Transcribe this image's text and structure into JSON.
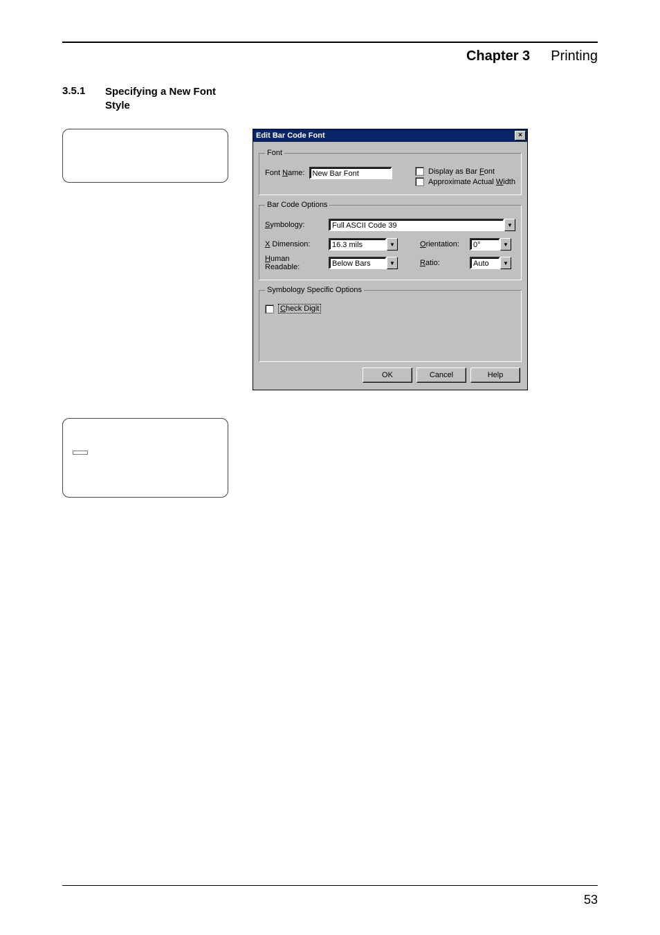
{
  "header": {
    "chapter": "Chapter 3",
    "title": "Printing"
  },
  "section": {
    "number": "3.5.1",
    "title": "Specifying a New Font Style"
  },
  "left_box1": {
    "l1": "",
    "l2": "",
    "l3": ""
  },
  "left_box2": {
    "l1": "",
    "l2": "",
    "btn": " ",
    "l3": "",
    "l4": "",
    "l5": ""
  },
  "dialog": {
    "title": "Edit Bar Code Font",
    "close": "×",
    "font_group": "Font",
    "font_name_label_pre": "Font ",
    "font_name_label_u": "N",
    "font_name_label_post": "ame:",
    "font_name_value": "New Bar Font",
    "display_barfont_pre": "Display as Bar ",
    "display_barfont_u": "F",
    "display_barfont_post": "ont",
    "approx_pre": "Approximate Actual ",
    "approx_u": "W",
    "approx_post": "idth",
    "barcode_group": "Bar Code Options",
    "symbology_u": "S",
    "symbology_post": "ymbology:",
    "symbology_value": "Full ASCII Code 39",
    "xdim_u": "X",
    "xdim_post": " Dimension:",
    "xdim_value": "16.3 mils",
    "orientation_u": "O",
    "orientation_post": "rientation:",
    "orientation_value": "0°",
    "human_u": "H",
    "human_post": "uman Readable:",
    "human_value": "Below Bars",
    "ratio_u": "R",
    "ratio_post": "atio:",
    "ratio_value": "Auto",
    "symspec_group": "Symbology Specific Options",
    "checkdigit_u": "C",
    "checkdigit_post": "heck Digit",
    "ok": "OK",
    "cancel": "Cancel",
    "help": "Help"
  },
  "footer": {
    "page": "53"
  }
}
